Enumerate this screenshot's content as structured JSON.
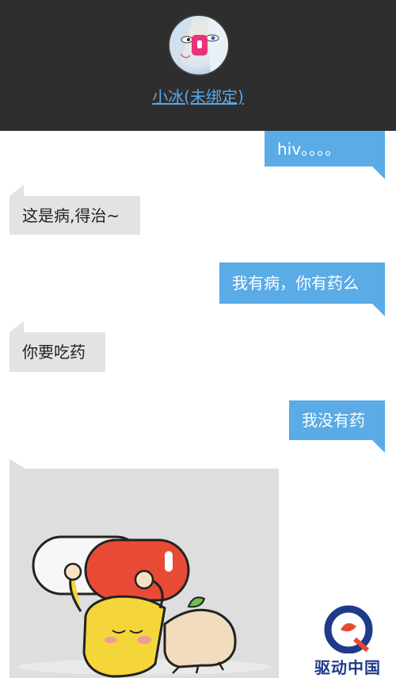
{
  "header": {
    "contact_name": "小冰(未绑定)"
  },
  "messages": [
    {
      "side": "right",
      "text": "hiv。。。。"
    },
    {
      "side": "left",
      "text": "这是病,得治~"
    },
    {
      "side": "right",
      "text": "我有病，你有药么"
    },
    {
      "side": "left",
      "text": "你要吃药"
    },
    {
      "side": "right",
      "text": "我没有药"
    }
  ],
  "watermark": {
    "text": "驱动中国"
  },
  "colors": {
    "header_bg": "#2e2e2e",
    "link": "#5aa6e8",
    "outgoing_bubble": "#5aabe6",
    "incoming_bubble": "#e3e3e3"
  }
}
